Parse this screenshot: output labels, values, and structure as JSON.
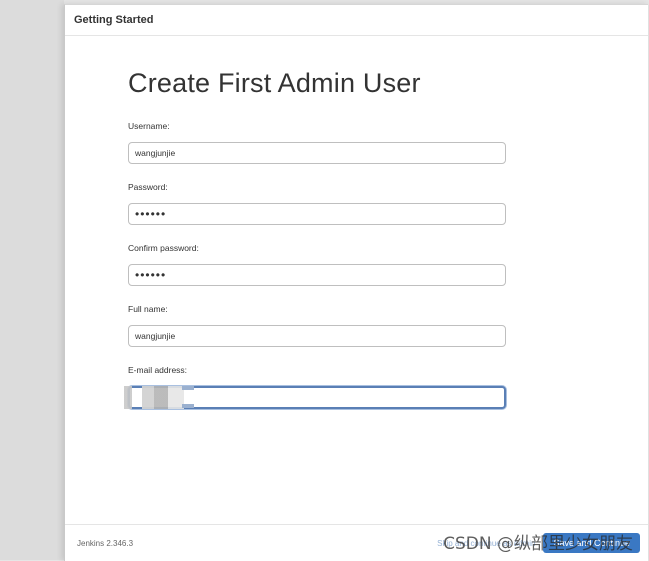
{
  "dialog": {
    "title": "Getting Started"
  },
  "form": {
    "heading": "Create First Admin User",
    "fields": [
      {
        "label": "Username:",
        "value": "wangjunjie"
      },
      {
        "label": "Password:",
        "value": "••••••"
      },
      {
        "label": "Confirm password:",
        "value": "••••••"
      },
      {
        "label": "Full name:",
        "value": "wangjunjie"
      },
      {
        "label": "E-mail address:",
        "value": ""
      }
    ]
  },
  "footer": {
    "version": "Jenkins 2.346.3",
    "skip_label": "Skip and continue as admin",
    "save_label": "Save and Continue"
  },
  "watermark": "CSDN @纵部里少女朋友"
}
